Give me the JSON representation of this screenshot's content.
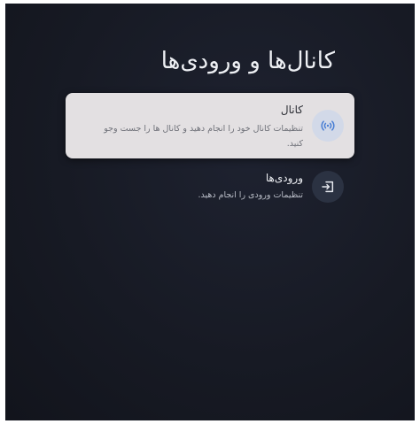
{
  "page": {
    "title": "کانال‌ها و ورودی‌ها"
  },
  "menu": {
    "items": [
      {
        "title": "کانال",
        "subtitle": "تنظیمات کانال خود را انجام دهید و کانال ها را جست وجو کنید.",
        "icon": "antenna-icon",
        "selected": true
      },
      {
        "title": "ورودی‌ها",
        "subtitle": "تنظیمات ورودی را انجام دهید.",
        "icon": "input-icon",
        "selected": false
      }
    ]
  },
  "colors": {
    "background": "#171a24",
    "selected_card": "#e3e0e2",
    "accent_icon": "#4a7fd4"
  }
}
